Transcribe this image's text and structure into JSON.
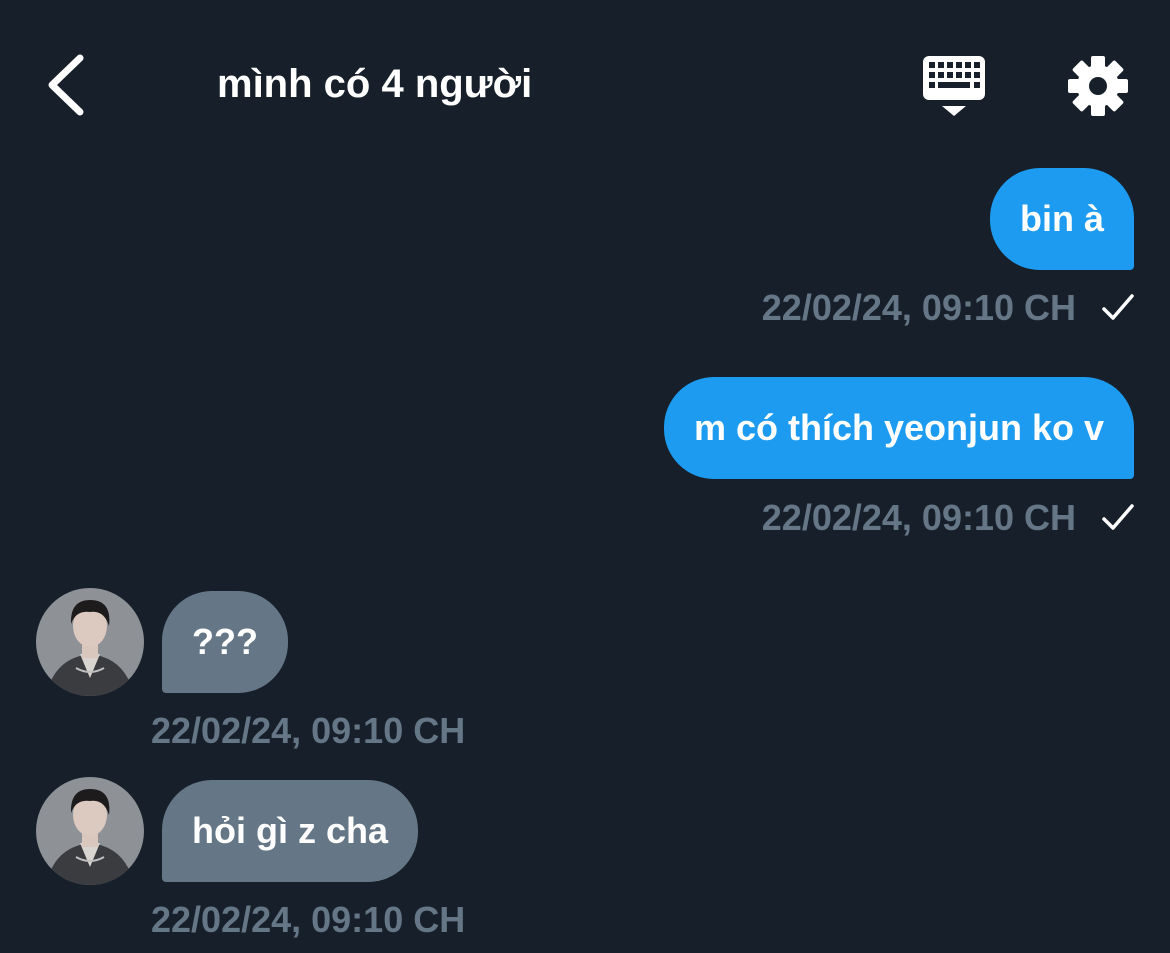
{
  "header": {
    "title": "mình có 4 người",
    "back_icon": "chevron-left-icon",
    "keyboard_icon": "keyboard-icon",
    "settings_icon": "gear-icon"
  },
  "colors": {
    "background": "#17202a",
    "sent_bubble": "#1d9bf0",
    "received_bubble": "#657786",
    "timestamp": "#657786",
    "text": "#ffffff"
  },
  "messages": [
    {
      "direction": "sent",
      "text": "bin à",
      "timestamp": "22/02/24, 09:10 CH",
      "status_icon": "checkmark-icon"
    },
    {
      "direction": "sent",
      "text": "m có thích yeonjun ko v",
      "timestamp": "22/02/24, 09:10 CH",
      "status_icon": "checkmark-icon"
    },
    {
      "direction": "received",
      "text": "???",
      "timestamp": "22/02/24, 09:10 CH",
      "avatar": "avatar"
    },
    {
      "direction": "received",
      "text": "hỏi gì z cha",
      "timestamp": "22/02/24, 09:10 CH",
      "avatar": "avatar"
    }
  ]
}
